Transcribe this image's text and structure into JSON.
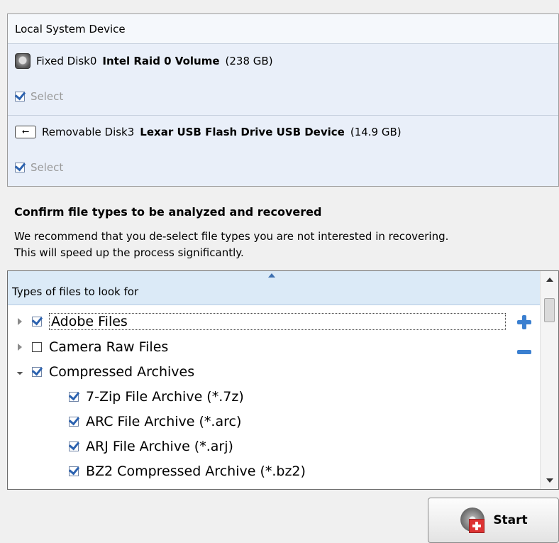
{
  "device_panel": {
    "header": "Local System Device",
    "devices": [
      {
        "prefix": "Fixed Disk0",
        "name": "Intel Raid 0 Volume",
        "size": "(238 GB)",
        "icon": "hard-disk-icon",
        "select_label": "Select",
        "selected": true
      },
      {
        "prefix": "Removable Disk3",
        "name": "Lexar USB Flash Drive USB Device",
        "size": "(14.9 GB)",
        "icon": "usb-icon",
        "select_label": "Select",
        "selected": true
      }
    ]
  },
  "confirm": {
    "title": "Confirm file types to be analyzed and recovered",
    "line1": "We recommend that you de-select file types you are not interested in recovering.",
    "line2": "This will speed up the process significantly."
  },
  "file_types": {
    "header": "Types of files to look for",
    "items": [
      {
        "label": "Adobe Files",
        "checked": true,
        "expander": "collapsed",
        "level": 0
      },
      {
        "label": "Camera Raw Files",
        "checked": false,
        "expander": "collapsed",
        "level": 0
      },
      {
        "label": "Compressed Archives",
        "checked": true,
        "expander": "expanded",
        "level": 0
      },
      {
        "label": "7-Zip File Archive (*.7z)",
        "checked": true,
        "level": 1
      },
      {
        "label": "ARC File Archive (*.arc)",
        "checked": true,
        "level": 1
      },
      {
        "label": "ARJ File Archive (*.arj)",
        "checked": true,
        "level": 1
      },
      {
        "label": "BZ2 Compressed Archive (*.bz2)",
        "checked": true,
        "level": 1
      }
    ]
  },
  "start_button": {
    "label": "Start"
  },
  "colors": {
    "accent": "#3a7fd0",
    "panel_bg": "#e9eff9",
    "header_bg": "#dbeaf7"
  }
}
